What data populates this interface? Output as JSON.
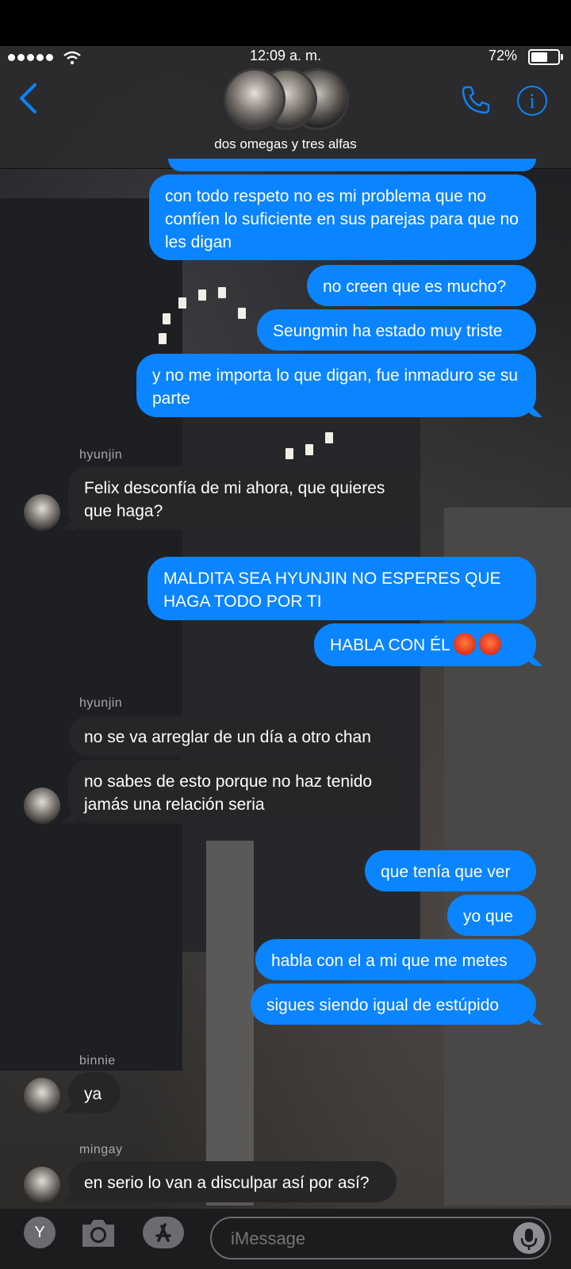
{
  "status": {
    "time": "12:09 a. m.",
    "battery": "72%",
    "battery_level": 0.72
  },
  "header": {
    "group_name": "dos omegas y tres alfas"
  },
  "messages": [
    {
      "text": "con todo respeto no es mi problema que no confíen lo suficiente en sus parejas para que no les digan"
    },
    {
      "text": "no creen que es mucho?"
    },
    {
      "text": "Seungmin ha estado muy triste"
    },
    {
      "text": "y no me importa lo que digan, fue inmaduro se su parte"
    },
    {
      "sender": "hyunjin",
      "text": "Felix desconfía de mi ahora, que quieres que haga?"
    },
    {
      "text": "MALDITA SEA HYUNJIN NO ESPERES QUE HAGA TODO POR TI"
    },
    {
      "text": "HABLA CON ÉL",
      "emoji": [
        "pouting-face",
        "pouting-face"
      ]
    },
    {
      "sender": "hyunjin",
      "text": "no se va arreglar de un día a otro chan"
    },
    {
      "text": "no sabes de esto porque no haz tenido jamás una relación seria"
    },
    {
      "text": "que tenía que ver"
    },
    {
      "text": "yo que"
    },
    {
      "text": "habla con el a mi que me metes"
    },
    {
      "text": "sigues siendo igual de estúpido"
    },
    {
      "sender": "binnie",
      "text": "ya"
    },
    {
      "sender": "mingay",
      "text": "en serio lo van a disculpar así por así?"
    }
  ],
  "input": {
    "placeholder": "iMessage"
  },
  "toolbar": {
    "app_label": "Y"
  },
  "colors": {
    "outgoing": "#0a84ff",
    "incoming": "#262628",
    "accent": "#0a84ff"
  }
}
